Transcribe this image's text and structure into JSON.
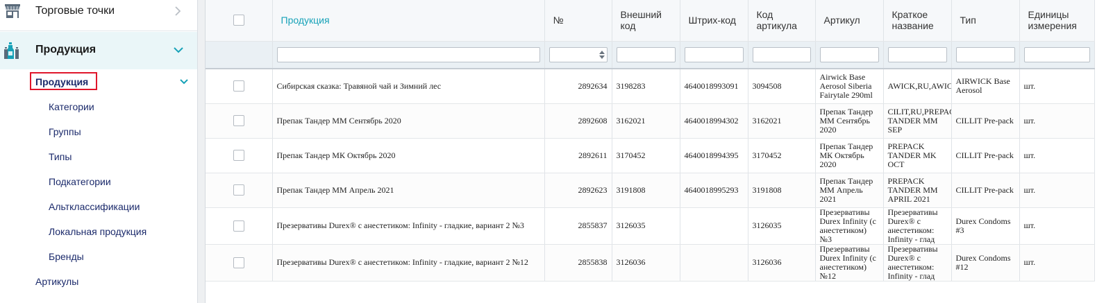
{
  "sidebar": {
    "top_item": "Торговые точки",
    "products_section": "Продукция",
    "products_sub": "Продукция",
    "sub_items": [
      "Категории",
      "Группы",
      "Типы",
      "Подкатегории",
      "Альтклассификации",
      "Локальная продукция",
      "Бренды"
    ],
    "articles": "Артикулы"
  },
  "table": {
    "columns": [
      "Продукция",
      "№",
      "Внешний код",
      "Штрих-код",
      "Код артикула",
      "Артикул",
      "Краткое название",
      "Тип",
      "Единицы измерения"
    ],
    "rows": [
      {
        "name": "Сибирская сказка: Травяной чай и Зимний лес",
        "num": "2892634",
        "ext": "3198283",
        "barcode": "4640018993091",
        "art_code": "3094508",
        "article": "Airwick Base Aerosol Siberia Fairytale 290ml",
        "short": "AWICK,RU,AWIC",
        "type": "AIRWICK Base Aerosol",
        "unit": "шт."
      },
      {
        "name": "Препак Тандер ММ Сентябрь 2020",
        "num": "2892608",
        "ext": "3162021",
        "barcode": "4640018994302",
        "art_code": "3162021",
        "article": "Препак Тандер ММ Сентябрь 2020",
        "short": "CILIT,RU,PREPAC TANDER MM SEP",
        "type": "CILLIT Pre-pack",
        "unit": "шт."
      },
      {
        "name": "Препак Тандер МК Октябрь 2020",
        "num": "2892611",
        "ext": "3170452",
        "barcode": "4640018994395",
        "art_code": "3170452",
        "article": "Препак Тандер МК Октябрь 2020",
        "short": "PREPACK TANDER MK OCT",
        "type": "CILLIT Pre-pack",
        "unit": "шт."
      },
      {
        "name": "Препак Тандер ММ Апрель 2021",
        "num": "2892623",
        "ext": "3191808",
        "barcode": "4640018995293",
        "art_code": "3191808",
        "article": "Препак Тандер ММ Апрель 2021",
        "short": "PREPACK TANDER MM APRIL 2021",
        "type": "CILLIT Pre-pack",
        "unit": "шт."
      },
      {
        "name": "Презервативы Durex® с анестетиком: Infinity - гладкие, вариант 2 №3",
        "num": "2855837",
        "ext": "3126035",
        "barcode": "",
        "art_code": "3126035",
        "article": "Презервативы Durex Infinity (с анестетиком) №3",
        "short": "Презервативы Durex® с анестетиком: Infinity - глад",
        "type": "Durex Condoms #3",
        "unit": "шт."
      },
      {
        "name": "Презервативы Durex® с анестетиком: Infinity - гладкие, вариант 2 №12",
        "num": "2855838",
        "ext": "3126036",
        "barcode": "",
        "art_code": "3126036",
        "article": "Презервативы Durex Infinity (с анестетиком) №12",
        "short": "Презервативы Durex® с анестетиком: Infinity - глад",
        "type": "Durex Condoms #12",
        "unit": "шт."
      }
    ]
  },
  "icons": {
    "store": "store-icon",
    "products": "bottles-icon",
    "chevron_right": "chevron-right-icon",
    "chevron_down": "chevron-down-icon"
  },
  "colors": {
    "accent": "#17a2b8",
    "nav_text": "#1b2a6b",
    "highlight_border": "#e0162b",
    "active_bg": "#eaf6f8"
  }
}
